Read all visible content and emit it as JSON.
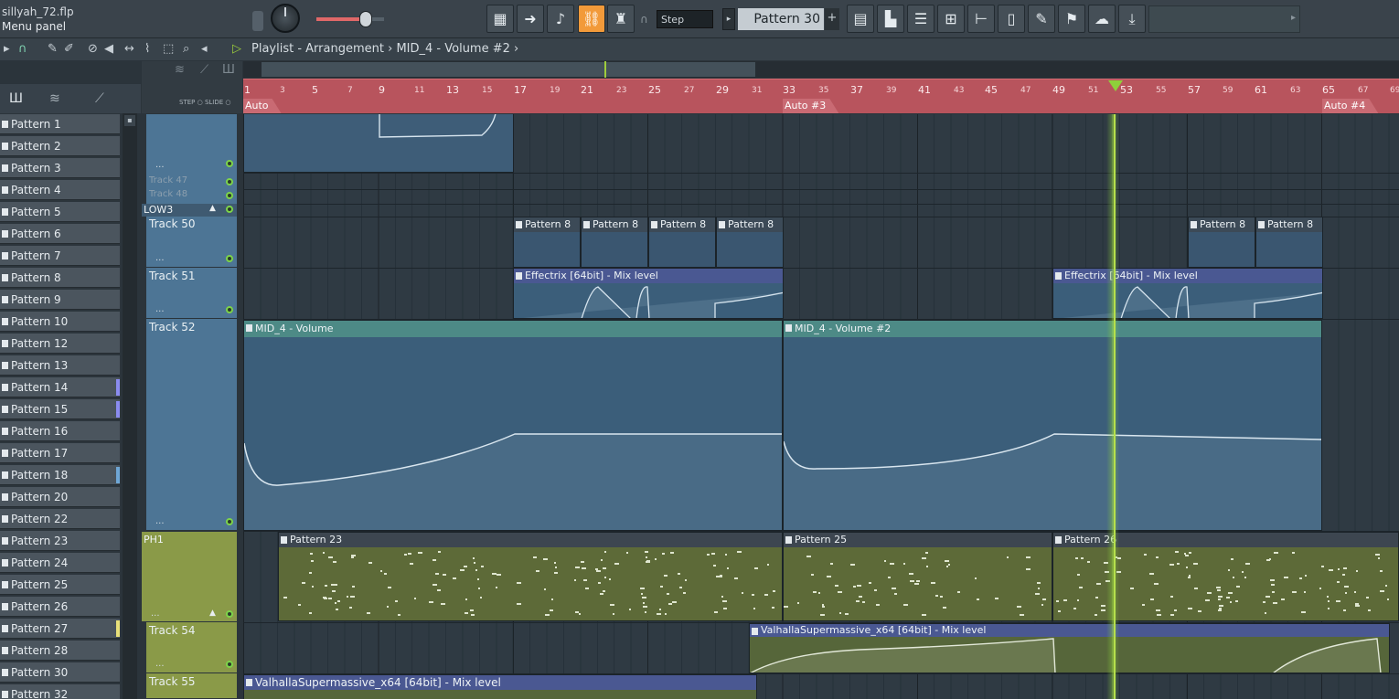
{
  "app": {
    "file_name": "sillyah_72.flp",
    "menu_label": "Menu panel"
  },
  "toolbar": {
    "snap_mode": "Step",
    "pattern_selected": "Pattern 30",
    "pattern_add": "+",
    "pattern_prev": "▸",
    "buttons": [
      "piano-roll-icon",
      "arrow-icon",
      "brush-icon",
      "link-icon",
      "stamp-icon",
      "grid-icon",
      "mixer-icon",
      "channel-rack-icon",
      "browser-icon",
      "plugin-icon",
      "cable-icon",
      "export-icon",
      "render-icon"
    ],
    "accent_color": "#f29a3a"
  },
  "playlist": {
    "breadcrumb_play": "▷",
    "breadcrumb": "Playlist - Arrangement",
    "breadcrumb_sep": "›",
    "current_clip": "MID_4 - Volume #2",
    "step_label": "STEP",
    "slide_label": "SLIDE"
  },
  "ruler": {
    "major": [
      "1",
      "5",
      "9",
      "13",
      "17",
      "21",
      "25",
      "29",
      "33",
      "37",
      "41",
      "45",
      "49",
      "53",
      "57",
      "61",
      "65"
    ],
    "minor": [
      "3",
      "7",
      "11",
      "15",
      "19",
      "23",
      "27",
      "31",
      "35",
      "39",
      "43",
      "47",
      "51",
      "55",
      "59",
      "63",
      "67"
    ],
    "edge": "69",
    "auto_markers": [
      "Auto",
      "Auto #3",
      "Auto #4"
    ],
    "ruler_color": "#b8545d",
    "playhead_color": "#8ed13a"
  },
  "picker": {
    "items": [
      {
        "label": "Pattern 1",
        "color": ""
      },
      {
        "label": "Pattern 2",
        "color": ""
      },
      {
        "label": "Pattern 3",
        "color": ""
      },
      {
        "label": "Pattern 4",
        "color": ""
      },
      {
        "label": "Pattern 5",
        "color": ""
      },
      {
        "label": "Pattern 6",
        "color": ""
      },
      {
        "label": "Pattern 7",
        "color": ""
      },
      {
        "label": "Pattern 8",
        "color": ""
      },
      {
        "label": "Pattern 9",
        "color": ""
      },
      {
        "label": "Pattern 10",
        "color": ""
      },
      {
        "label": "Pattern 12",
        "color": ""
      },
      {
        "label": "Pattern 13",
        "color": ""
      },
      {
        "label": "Pattern 14",
        "color": "#8b8cf0"
      },
      {
        "label": "Pattern 15",
        "color": "#8b8cf0"
      },
      {
        "label": "Pattern 16",
        "color": ""
      },
      {
        "label": "Pattern 17",
        "color": ""
      },
      {
        "label": "Pattern 18",
        "color": "#6fa7d6"
      },
      {
        "label": "Pattern 20",
        "color": ""
      },
      {
        "label": "Pattern 22",
        "color": ""
      },
      {
        "label": "Pattern 23",
        "color": ""
      },
      {
        "label": "Pattern 24",
        "color": ""
      },
      {
        "label": "Pattern 25",
        "color": ""
      },
      {
        "label": "Pattern 26",
        "color": ""
      },
      {
        "label": "Pattern 27",
        "color": "#e8e07a"
      },
      {
        "label": "Pattern 28",
        "color": ""
      },
      {
        "label": "Pattern 30",
        "color": ""
      },
      {
        "label": "Pattern 32",
        "color": ""
      }
    ]
  },
  "tracks": {
    "track47": "Track 47",
    "track48": "Track 48",
    "group_low": "LOW3",
    "track50": "Track 50",
    "track51": "Track 51",
    "track52": "Track 52",
    "group_ph": "PH1",
    "track54": "Track 54",
    "track55": "Track 55",
    "dots": "...",
    "blue_color": "#4d7595",
    "green_color": "#8a9a48"
  },
  "clips": {
    "pattern8": "Pattern 8",
    "effectrix": "Effectrix [64bit] - Mix level",
    "mid4_volume": "MID_4 - Volume",
    "mid4_volume2": "MID_4 - Volume #2",
    "pattern23": "Pattern 23",
    "pattern25": "Pattern 25",
    "pattern26": "Pattern 26",
    "valhalla": "ValhallaSupermassive_x64 [64bit] - Mix level"
  }
}
